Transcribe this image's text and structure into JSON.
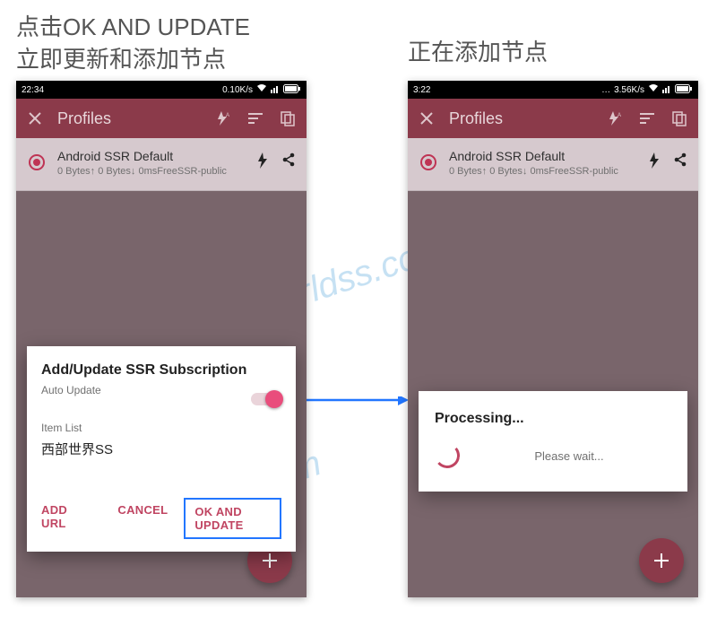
{
  "captions": {
    "left_line1": "点击OK AND UPDATE",
    "left_line2": "立即更新和添加节点",
    "right": "正在添加节点"
  },
  "watermark": "westworldss.com",
  "phone1": {
    "status": {
      "time": "22:34",
      "net": "0.10K/s"
    },
    "toolbar": {
      "title": "Profiles"
    },
    "profile": {
      "title": "Android SSR Default",
      "sub": "0 Bytes↑ 0 Bytes↓ 0msFreeSSR-public"
    },
    "dialog": {
      "title": "Add/Update SSR Subscription",
      "auto_update": "Auto Update",
      "item_list": "Item List",
      "item": "西部世界SS",
      "actions": {
        "add_url": "ADD URL",
        "cancel": "CANCEL",
        "ok": "OK AND UPDATE"
      }
    }
  },
  "phone2": {
    "status": {
      "time": "3:22",
      "net": "3.56K/s"
    },
    "toolbar": {
      "title": "Profiles"
    },
    "profile": {
      "title": "Android SSR Default",
      "sub": "0 Bytes↑ 0 Bytes↓ 0msFreeSSR-public"
    },
    "dialog": {
      "title": "Processing...",
      "wait": "Please wait..."
    }
  }
}
